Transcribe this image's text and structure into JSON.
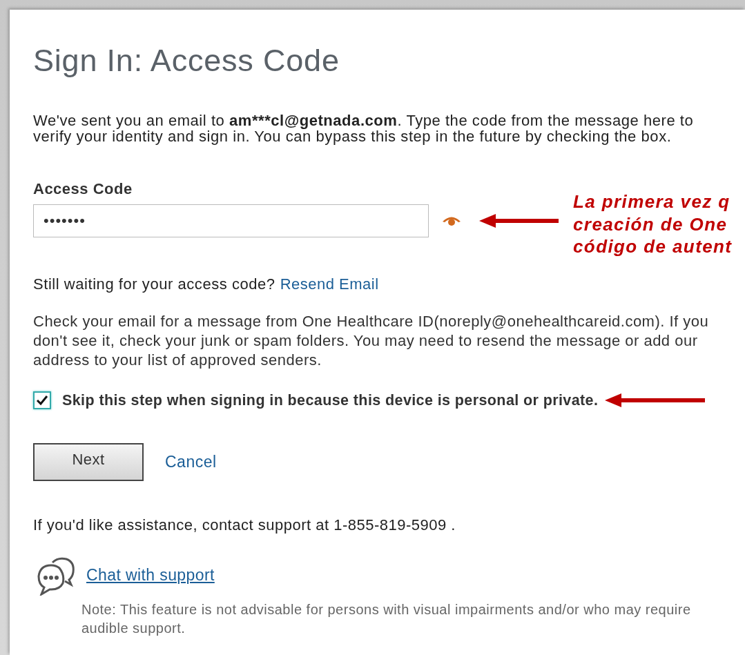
{
  "page": {
    "title": "Sign In: Access Code",
    "intro": [
      {
        "text": "We've sent you an email to ",
        "bold": false
      },
      {
        "text": "am***cl@getnada.com",
        "bold": true
      },
      {
        "text": ". Type the code from the message here to verify your identity and sign in. You can bypass this step in the future by checking the box.",
        "bold": false
      }
    ]
  },
  "access_code": {
    "label": "Access Code",
    "value": "•••••••"
  },
  "resend": {
    "text": "Still waiting for your access code?",
    "link": "Resend Email"
  },
  "help_text": "Check your email for a message from One Healthcare ID(noreply@onehealthcareid.com). If you don't see it, check your junk or spam folders. You may need to resend the message or add our address to your list of approved senders.",
  "skip_step": {
    "label": "Skip this step when signing in because this device is personal or private.",
    "checked": true
  },
  "buttons": {
    "next": "Next",
    "cancel": "Cancel"
  },
  "assistance": "If you'd like assistance, contact support at 1-855-819-5909 .",
  "chat": {
    "link": "Chat with support",
    "note": "Note: This feature is not advisable for persons with visual impairments and/or who may require audible support."
  },
  "annotation": {
    "lines": [
      "La primera vez q",
      "creación de One",
      "código de autent"
    ]
  }
}
